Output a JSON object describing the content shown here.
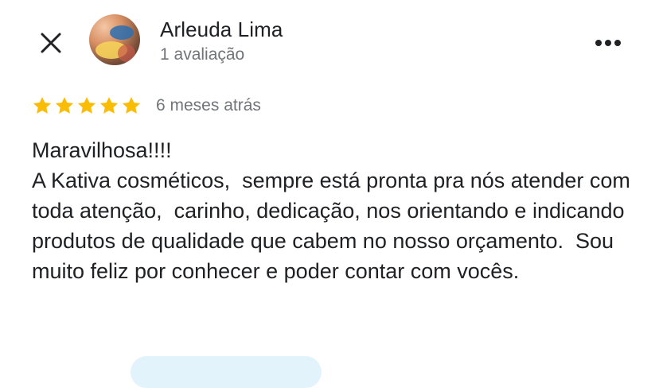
{
  "reviewer": {
    "name": "Arleuda Lima",
    "review_count": "1 avaliação",
    "avatar_icon": "profile-photo"
  },
  "header": {
    "close_icon": "close-icon",
    "more_icon": "more-horizontal-icon"
  },
  "review": {
    "stars": 5,
    "max_stars": 5,
    "time_ago": "6 meses atrás",
    "text": "Maravilhosa!!!!\nA Kativa cosméticos,  sempre está pronta pra nós atender com toda atenção,  carinho, dedicação, nos orientando e indicando produtos de qualidade que cabem no nosso orçamento.  Sou muito feliz por conhecer e poder contar com vocês."
  },
  "colors": {
    "star": "#fbbc04",
    "text_primary": "#202124",
    "text_secondary": "#70757a",
    "pill": "#e2f3fb"
  }
}
